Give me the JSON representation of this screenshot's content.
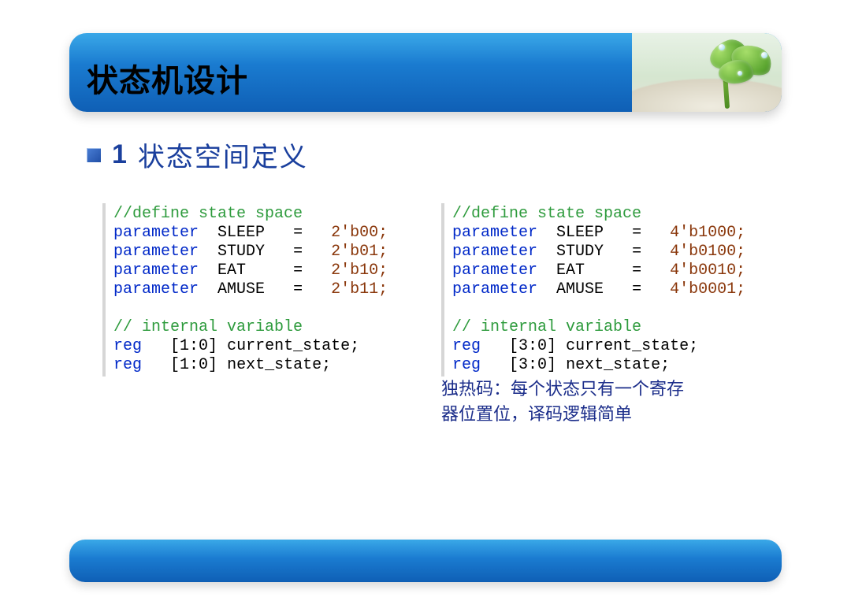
{
  "header": {
    "title": "状态机设计"
  },
  "section": {
    "number": "1",
    "title": "状态空间定义"
  },
  "code_left": {
    "comment1": "//define state space",
    "p1": {
      "kw": "parameter",
      "name": "SLEEP",
      "eq": "=",
      "val": "2'b00;"
    },
    "p2": {
      "kw": "parameter",
      "name": "STUDY",
      "eq": "=",
      "val": "2'b01;"
    },
    "p3": {
      "kw": "parameter",
      "name": "EAT",
      "eq": "=",
      "val": "2'b10;"
    },
    "p4": {
      "kw": "parameter",
      "name": "AMUSE",
      "eq": "=",
      "val": "2'b11;"
    },
    "comment2": "// internal variable",
    "r1": {
      "kw": "reg",
      "range": "[1:0]",
      "name": "current_state;"
    },
    "r2": {
      "kw": "reg",
      "range": "[1:0]",
      "name": "next_state;"
    }
  },
  "code_right": {
    "comment1": "//define state space",
    "p1": {
      "kw": "parameter",
      "name": "SLEEP",
      "eq": "=",
      "val": "4'b1000;"
    },
    "p2": {
      "kw": "parameter",
      "name": "STUDY",
      "eq": "=",
      "val": "4'b0100;"
    },
    "p3": {
      "kw": "parameter",
      "name": "EAT",
      "eq": "=",
      "val": "4'b0010;"
    },
    "p4": {
      "kw": "parameter",
      "name": "AMUSE",
      "eq": "=",
      "val": "4'b0001;"
    },
    "comment2": "// internal variable",
    "r1": {
      "kw": "reg",
      "range": "[3:0]",
      "name": "current_state;"
    },
    "r2": {
      "kw": "reg",
      "range": "[3:0]",
      "name": "next_state;"
    }
  },
  "note": "独热码：每个状态只有一个寄存器位置位，译码逻辑简单"
}
